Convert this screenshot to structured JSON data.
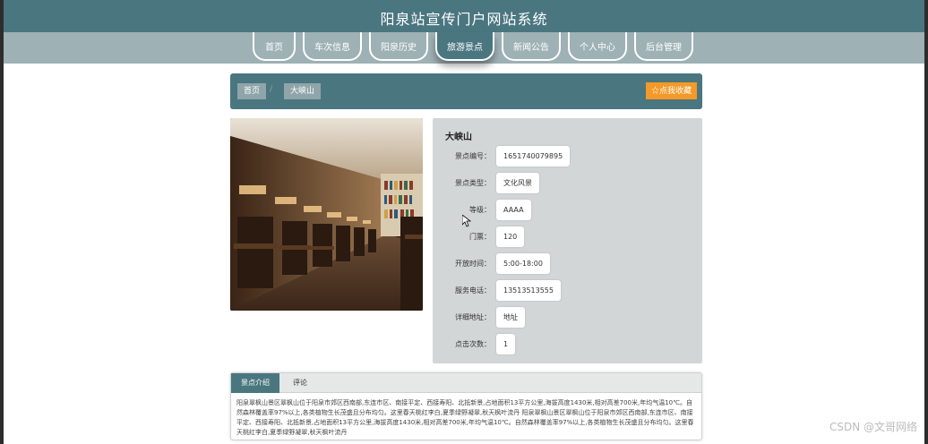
{
  "app": {
    "title": "阳泉站宣传门户网站系统"
  },
  "nav": {
    "items": [
      {
        "label": "首页"
      },
      {
        "label": "车次信息"
      },
      {
        "label": "阳泉历史"
      },
      {
        "label": "旅游景点"
      },
      {
        "label": "新闻公告"
      },
      {
        "label": "个人中心"
      },
      {
        "label": "后台管理"
      }
    ],
    "active": "旅游景点"
  },
  "breadcrumb": {
    "home": "首页",
    "separator": "/",
    "current": "大峡山"
  },
  "favorite_button": {
    "icon": "star-outline-icon",
    "label": "点我收藏"
  },
  "details": {
    "title": "大峡山",
    "fields": [
      {
        "label": "景点编号：",
        "value": "1651740079895"
      },
      {
        "label": "景点类型：",
        "value": "文化风景"
      },
      {
        "label": "等级：",
        "value": "AAAA"
      },
      {
        "label": "门票：",
        "value": "120"
      },
      {
        "label": "开放时间：",
        "value": "5:00-18:00"
      },
      {
        "label": "服务电话：",
        "value": "13513513555"
      },
      {
        "label": "详细地址：",
        "value": "地址"
      },
      {
        "label": "点击次数：",
        "value": "1"
      }
    ]
  },
  "tabs": {
    "items": [
      {
        "label": "景点介绍"
      },
      {
        "label": "评论"
      }
    ],
    "active": "景点介绍",
    "content": "阳泉翠枫山景区翠枫山位于阳泉市郊区西南部,东连市区、南接平定、西接寿阳、北抵新景,占地面积13平方公里,海拔高度1430米,相对高差700米,年均气温10℃。自然森林覆盖率97%以上,各类植物生长茂盛且分布均匀。这里春天桃红李白,夏季绿野凝翠,秋天枫叶流丹 阳泉翠枫山景区翠枫山位于阳泉市郊区西南部,东连市区、南接平定、西接寿阳、北抵新景,占地面积13平方公里,海拔高度1430米,相对高差700米,年均气温10℃。自然森林覆盖率97%以上,各类植物生长茂盛且分布均匀。这里春天桃红李白,夏季绿野凝翠,秋天枫叶流丹"
  },
  "watermark": "CSDN @文哥网络",
  "colors": {
    "header": "#4a7680",
    "nav": "#9eb1b5",
    "accent": "#f39a28",
    "details_bg": "#d2d6d6"
  }
}
